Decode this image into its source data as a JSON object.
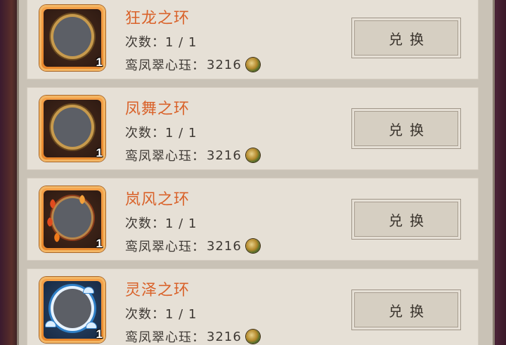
{
  "rewards": [
    {
      "title": "狂龙之环",
      "times_label": "次数：",
      "times_value": "1 / 1",
      "cost_label": "鸾凤翠心珏：",
      "cost_value": "3216",
      "count": "1",
      "exchange_label": "兑换",
      "icon": "dragon-ring-icon"
    },
    {
      "title": "凤舞之环",
      "times_label": "次数：",
      "times_value": "1 / 1",
      "cost_label": "鸾凤翠心珏：",
      "cost_value": "3216",
      "count": "1",
      "exchange_label": "兑换",
      "icon": "phoenix-ring-icon"
    },
    {
      "title": "岚风之环",
      "times_label": "次数：",
      "times_value": "1 / 1",
      "cost_label": "鸾凤翠心珏：",
      "cost_value": "3216",
      "count": "1",
      "exchange_label": "兑换",
      "icon": "maple-ring-icon"
    },
    {
      "title": "灵泽之环",
      "times_label": "次数：",
      "times_value": "1 / 1",
      "cost_label": "鸾凤翠心珏：",
      "cost_value": "3216",
      "count": "1",
      "exchange_label": "兑换",
      "icon": "wave-ring-icon"
    }
  ],
  "colors": {
    "title": "#d9622a",
    "card": "#e6e0d6",
    "panel": "#c9c2b6",
    "icon_frame": "#e8862b"
  }
}
